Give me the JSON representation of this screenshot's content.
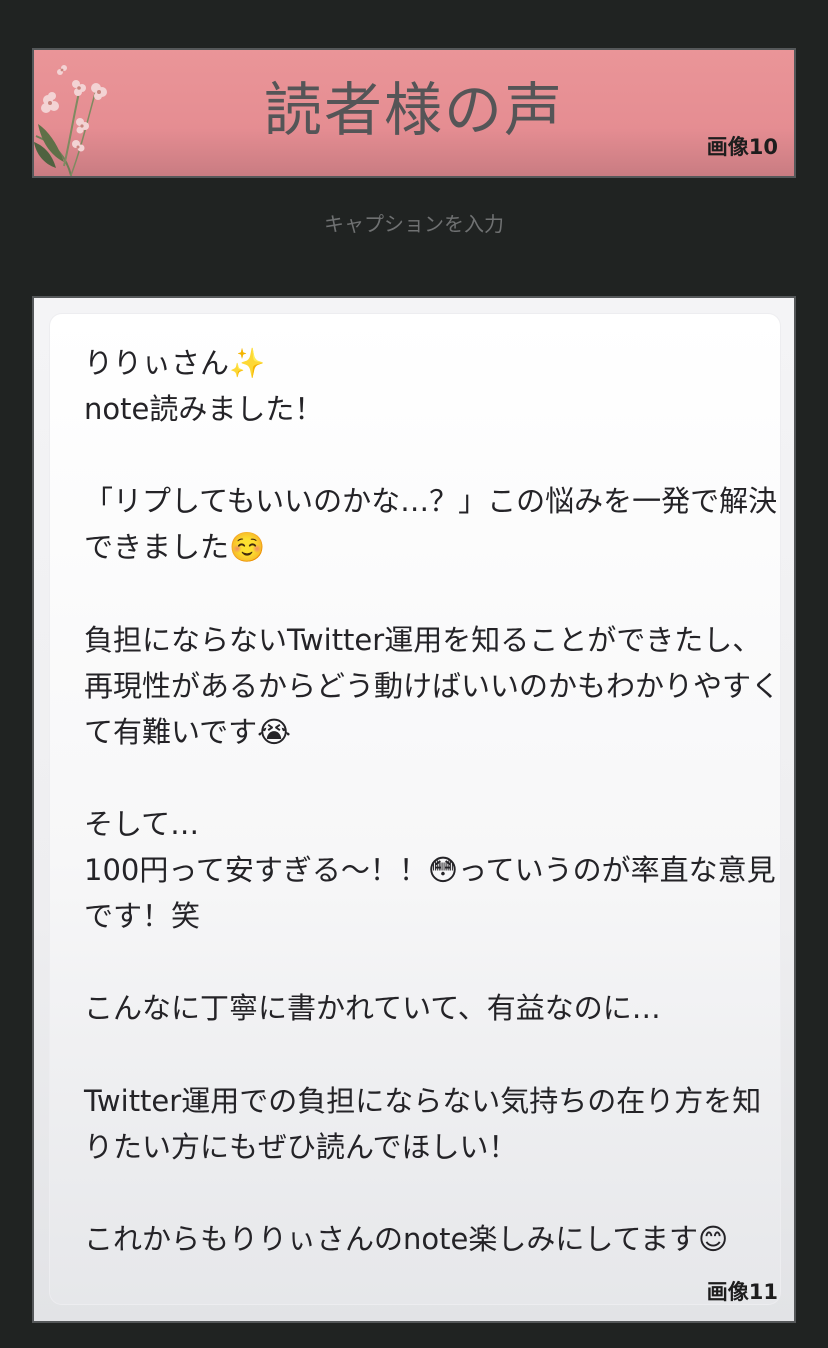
{
  "image10": {
    "title": "読者様の声",
    "label": "画像10"
  },
  "caption": {
    "placeholder": "キャプションを入力"
  },
  "image11": {
    "label": "画像11",
    "text": "りりぃさん✨\nnote読みました！\n\n「リプしてもいいのかな…？」この悩みを一発で解決できました☺️\n\n負担にならないTwitter運用を知ることができたし、再現性があるからどう動けばいいのかもわかりやすくて有難いです😭\n\nそして…\n100円って安すぎる〜！！😳っていうのが率直な意見です！笑\n\nこんなに丁寧に書かれていて、有益なのに…\n\nTwitter運用での負担にならない気持ちの在り方を知りたい方にもぜひ読んでほしい！\n\nこれからもりりぃさんのnote楽しみにしてます😊"
  }
}
